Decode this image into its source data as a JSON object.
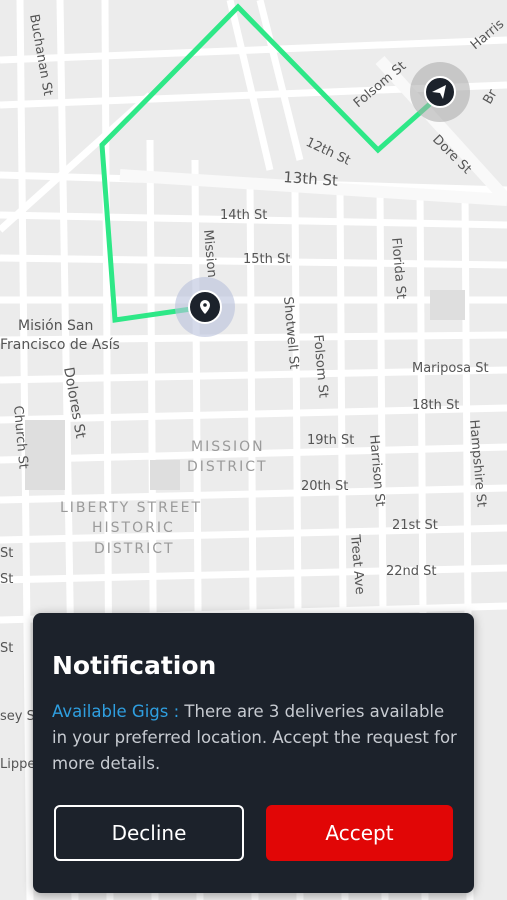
{
  "map": {
    "streets": [
      "Buchanan St",
      "Folsom St",
      "Harris",
      "12th St",
      "Dore St",
      "Br",
      "13th St",
      "14th St",
      "15th St",
      "Mission",
      "Florida St",
      "Shotwell St",
      "Folsom St",
      "Mariposa St",
      "18th St",
      "19th St",
      "Harrison St",
      "Hampshire St",
      "20th St",
      "21st St",
      "22nd St",
      "Treat Ave",
      "Dolores St",
      "Church St",
      "St",
      "St",
      "St",
      "sey S",
      "Lippe"
    ],
    "places": [
      "Misión San",
      "Francisco de Asís"
    ],
    "districts": [
      "MISSION",
      "DISTRICT",
      "LIBERTY STREET",
      "HISTORIC",
      "DISTRICT"
    ],
    "route_color": "#2ee887"
  },
  "notification": {
    "title": "Notification",
    "label": "Available Gigs :",
    "message": " There are 3 deliveries available in your preferred location. Accept the request for more details.",
    "decline_label": "Decline",
    "accept_label": "Accept",
    "accept_color": "#e10606"
  }
}
